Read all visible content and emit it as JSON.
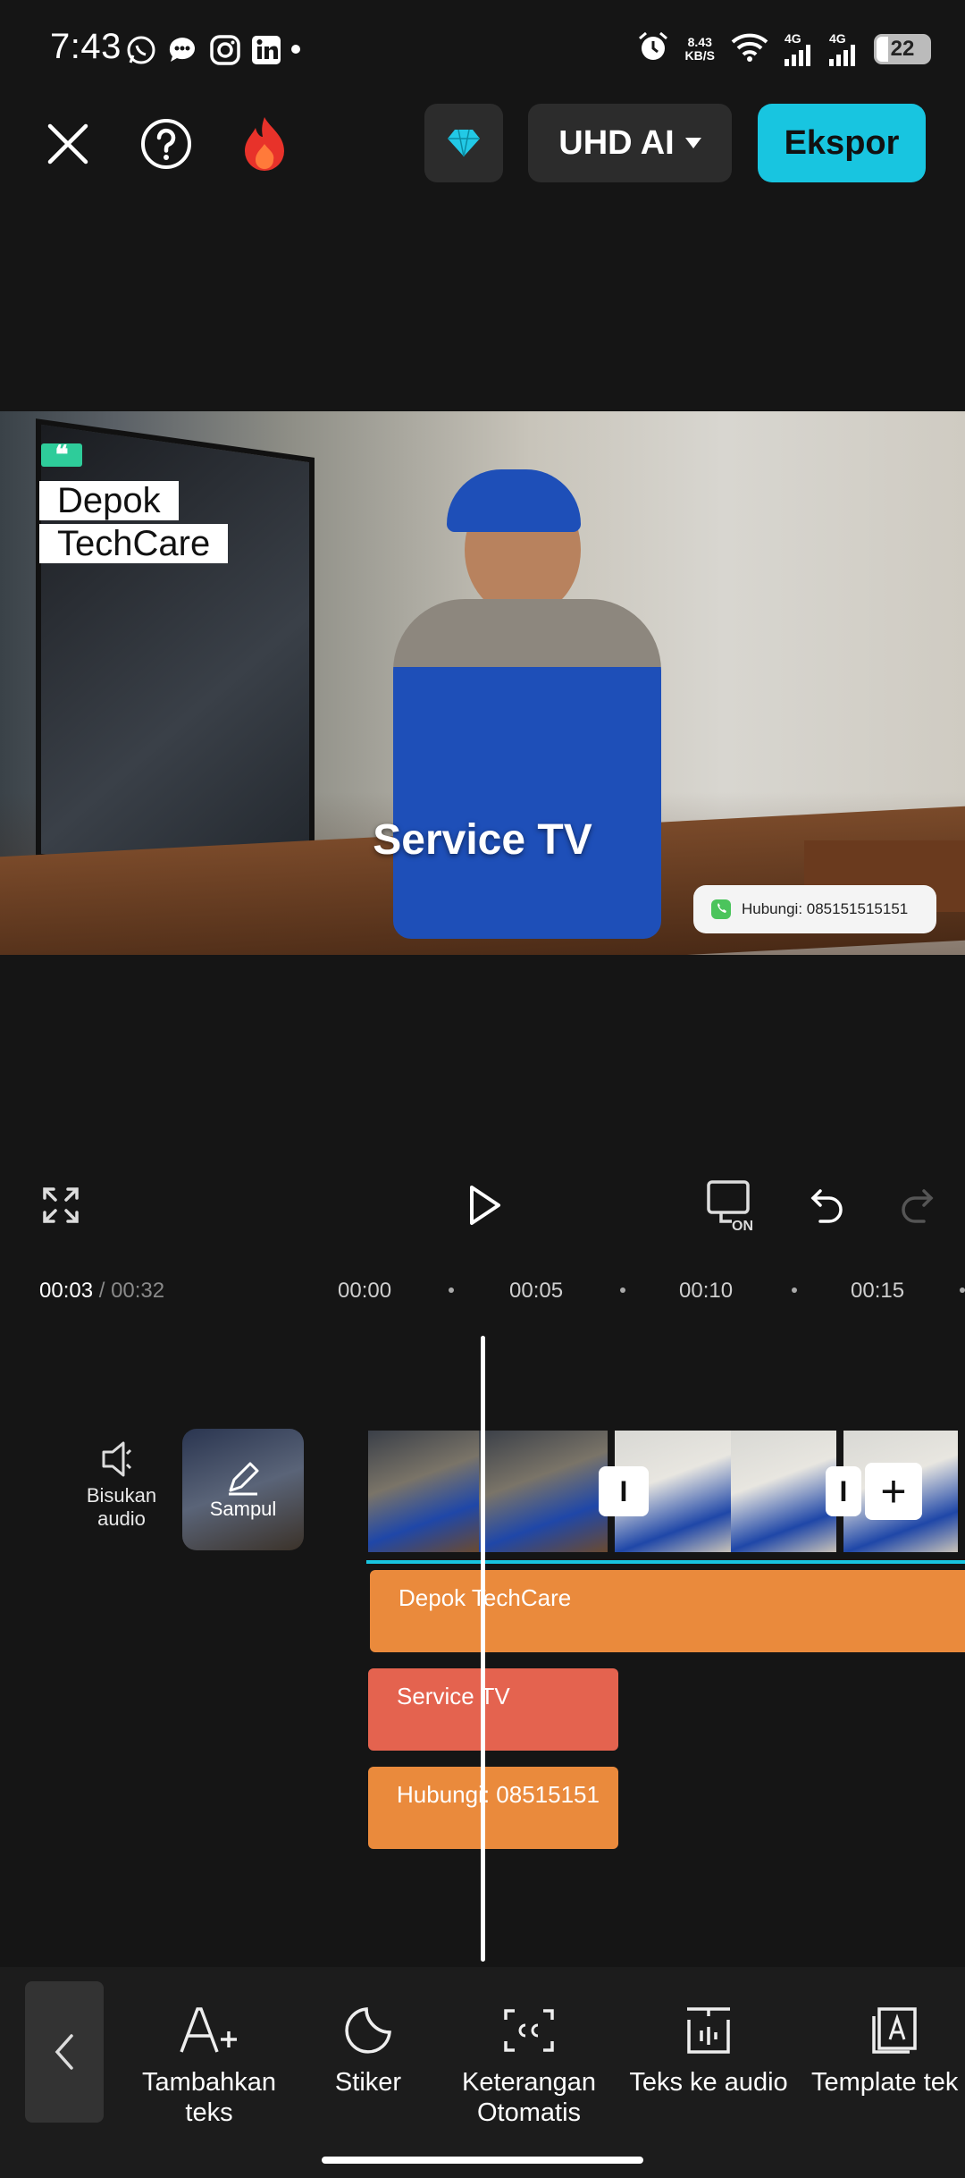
{
  "status_bar": {
    "time": "7:43",
    "net_speed_value": "8.43",
    "net_speed_unit": "KB/S",
    "signal1_label": "4G",
    "signal2_label": "4G",
    "battery": "22",
    "icons": [
      "whatsapp-icon",
      "chat-icon",
      "instagram-icon",
      "linkedin-icon",
      "alarm-icon",
      "wifi-icon",
      "signal-icon",
      "battery-icon"
    ]
  },
  "top_bar": {
    "resolution_label": "UHD AI",
    "export_label": "Ekspor",
    "accent_color": "#18c5e0"
  },
  "preview": {
    "title_line1": "Depok",
    "title_line2": "TechCare",
    "quote_mark": "❝",
    "caption": "Service TV",
    "contact": "Hubungi: 085151515151"
  },
  "timeline": {
    "current_time": "00:03",
    "total_time": "/ 00:32",
    "ruler": [
      "00:00",
      "00:05",
      "00:10",
      "00:15"
    ],
    "mute_label_line1": "Bisukan",
    "mute_label_line2": "audio",
    "cover_label": "Sampul",
    "clips": [
      {
        "label": "Depok TechCare",
        "color": "#ea8a3c"
      },
      {
        "label": "Service TV",
        "color": "#e4634f"
      },
      {
        "label": "Hubungi: 08515151",
        "color": "#ea8a3c"
      }
    ]
  },
  "toolbar": {
    "items": [
      {
        "line1": "Tambahkan",
        "line2": "teks"
      },
      {
        "line1": "Stiker",
        "line2": ""
      },
      {
        "line1": "Keterangan",
        "line2": "Otomatis"
      },
      {
        "line1": "Teks ke audio",
        "line2": ""
      },
      {
        "line1": "Template tek",
        "line2": ""
      }
    ]
  }
}
